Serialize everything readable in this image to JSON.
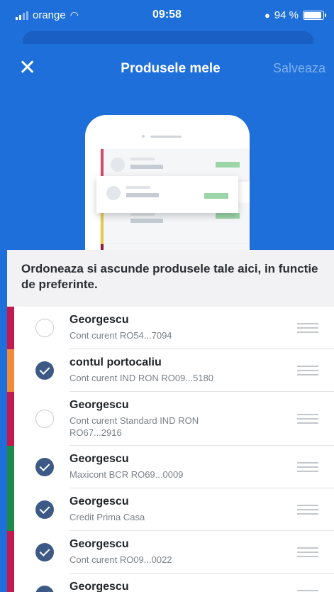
{
  "status_bar": {
    "carrier": "orange",
    "time": "09:58",
    "battery": "94 %"
  },
  "nav": {
    "title": "Produsele mele",
    "save_label": "Salveaza",
    "close_icon": "close-icon"
  },
  "instructions": "Ordoneaza si ascunde produsele tale aici, in functie de preferinte.",
  "colors": {
    "brand_blue": "#1e6fd9",
    "checked": "#3d5a86",
    "accent_magenta": "#c4194e",
    "accent_orange": "#f28a3a",
    "accent_green": "#1e8a4a"
  },
  "products": [
    {
      "name": "Georgescu",
      "details": "Cont curent   RO54...7094",
      "checked": false,
      "accent": "#c4194e"
    },
    {
      "name": "contul portocaliu",
      "details": "Cont curent IND RON   RO09...5180",
      "checked": true,
      "accent": "#f28a3a"
    },
    {
      "name": "Georgescu",
      "details": "Cont curent Standard IND RON RO67...2916",
      "checked": false,
      "accent": "#c4194e"
    },
    {
      "name": "Georgescu",
      "details": "Maxicont BCR   RO69...0009",
      "checked": true,
      "accent": "#1e8a4a"
    },
    {
      "name": "Georgescu",
      "details": "Credit Prima Casa",
      "checked": true,
      "accent": "#1e8a4a"
    },
    {
      "name": "Georgescu",
      "details": "Cont curent   RO09...0022",
      "checked": true,
      "accent": "#c4194e"
    },
    {
      "name": "Georgescu",
      "details": "",
      "checked": true,
      "accent": "#c4194e"
    }
  ]
}
